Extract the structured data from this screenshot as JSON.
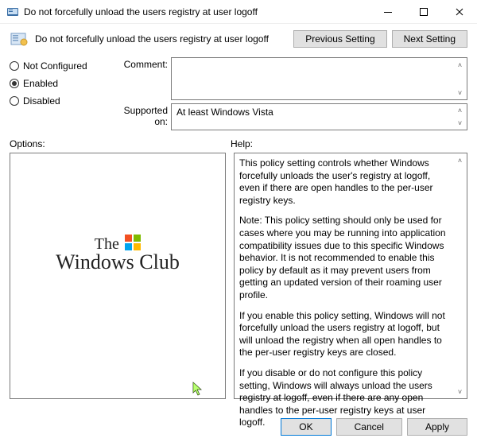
{
  "titlebar": {
    "title": "Do not forcefully unload the users registry at user logoff"
  },
  "header": {
    "title": "Do not forcefully unload the users registry at user logoff"
  },
  "nav": {
    "prev_label": "Previous Setting",
    "next_label": "Next Setting"
  },
  "config": {
    "radios": {
      "not_configured": "Not Configured",
      "enabled": "Enabled",
      "disabled": "Disabled",
      "selected": "enabled"
    },
    "comment_label": "Comment:",
    "comment_value": "",
    "supported_label": "Supported on:",
    "supported_value": "At least Windows Vista"
  },
  "panes": {
    "options_label": "Options:",
    "help_label": "Help:"
  },
  "help": {
    "p1": "This policy setting  controls whether Windows forcefully unloads the user's registry at logoff, even if there are open handles to the per-user registry keys.",
    "p2": "Note: This policy setting should only be used for cases where you may be running into application compatibility issues due to this specific Windows behavior. It is not recommended to enable this policy by default as it may prevent users from getting an updated version of their roaming user profile.",
    "p3": "If you enable this policy setting, Windows will not forcefully unload the users registry at logoff, but will unload the registry when all open handles to the per-user registry keys are closed.",
    "p4": "If you disable or do not configure this policy setting, Windows will always unload the users registry at logoff, even if there are any open handles to the per-user registry keys at user logoff."
  },
  "logo": {
    "line1": "The",
    "line2": "Windows Club"
  },
  "footer": {
    "ok_label": "OK",
    "cancel_label": "Cancel",
    "apply_label": "Apply"
  }
}
